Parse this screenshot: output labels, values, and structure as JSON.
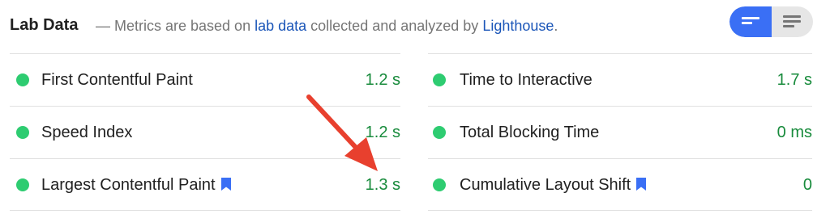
{
  "header": {
    "title": "Lab Data",
    "desc_prefix": "— Metrics are based on ",
    "desc_link1": "lab data",
    "desc_middle": " collected and analyzed by ",
    "desc_link2": "Lighthouse",
    "desc_suffix": "."
  },
  "toggle": {
    "active": "compact-view",
    "options": [
      "compact-view",
      "expanded-view"
    ]
  },
  "metrics_left": [
    {
      "label": "First Contentful Paint",
      "value": "1.2 s",
      "bookmark": false
    },
    {
      "label": "Speed Index",
      "value": "1.2 s",
      "bookmark": false
    },
    {
      "label": "Largest Contentful Paint",
      "value": "1.3 s",
      "bookmark": true
    }
  ],
  "metrics_right": [
    {
      "label": "Time to Interactive",
      "value": "1.7 s",
      "bookmark": false
    },
    {
      "label": "Total Blocking Time",
      "value": "0 ms",
      "bookmark": false
    },
    {
      "label": "Cumulative Layout Shift",
      "value": "0",
      "bookmark": true
    }
  ],
  "colors": {
    "pass": "#2ecc71",
    "pass_text": "#188b3c",
    "link": "#1a55b8",
    "accent": "#3a6ff5",
    "annotation": "#e8402e"
  },
  "icons": {
    "status": "green-circle-icon",
    "bookmark": "bookmark-icon",
    "annotation": "red-arrow-icon"
  }
}
